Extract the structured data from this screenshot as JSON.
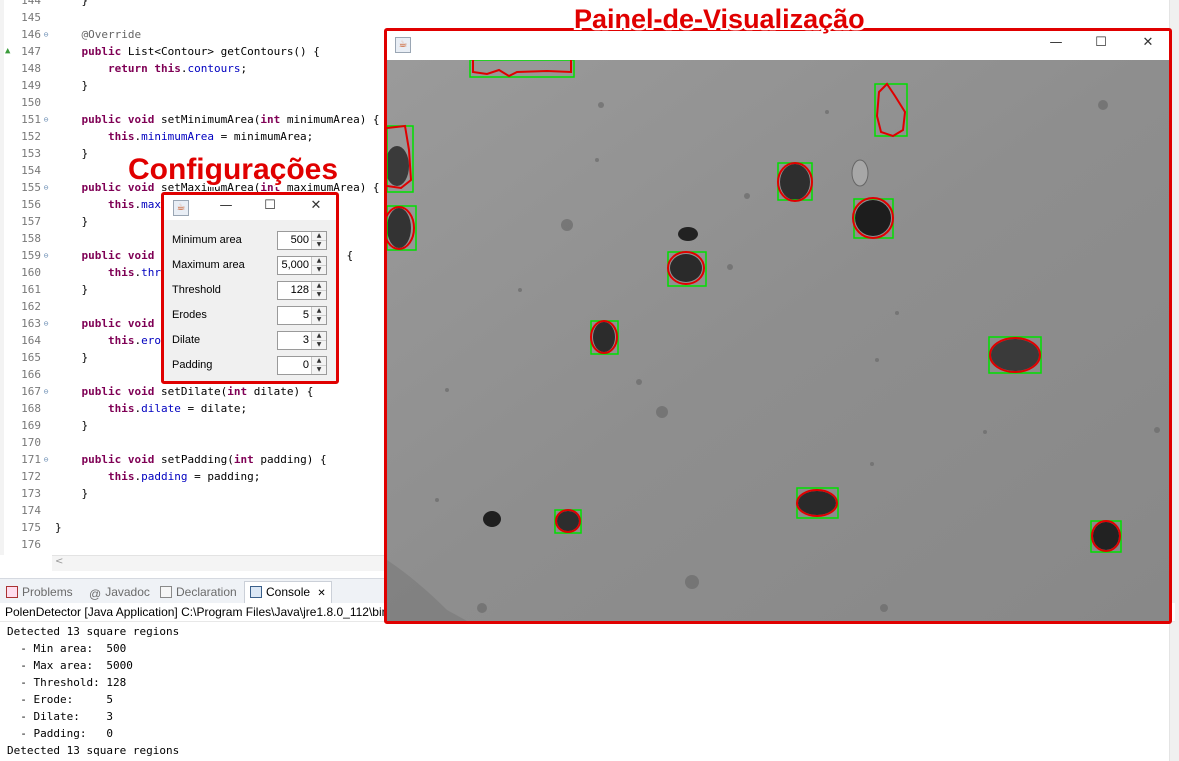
{
  "editor": {
    "lines": [
      {
        "num": "144",
        "code": "    }",
        "arrow": "",
        "fold": ""
      },
      {
        "num": "145",
        "code": "",
        "arrow": "",
        "fold": ""
      },
      {
        "num": "146",
        "code": "    @Override",
        "arrow": "",
        "fold": "⊖"
      },
      {
        "num": "147",
        "code": "    public List<Contour> getContours() {",
        "arrow": "▲",
        "fold": ""
      },
      {
        "num": "148",
        "code": "        return this.contours;",
        "arrow": "",
        "fold": ""
      },
      {
        "num": "149",
        "code": "    }",
        "arrow": "",
        "fold": ""
      },
      {
        "num": "150",
        "code": "",
        "arrow": "",
        "fold": ""
      },
      {
        "num": "151",
        "code": "    public void setMinimumArea(int minimumArea) {",
        "arrow": "",
        "fold": "⊖"
      },
      {
        "num": "152",
        "code": "        this.minimumArea = minimumArea;",
        "arrow": "",
        "fold": ""
      },
      {
        "num": "153",
        "code": "    }",
        "arrow": "",
        "fold": ""
      },
      {
        "num": "154",
        "code": "",
        "arrow": "",
        "fold": ""
      },
      {
        "num": "155",
        "code": "    public void setMaximumArea(int maximumArea) {",
        "arrow": "",
        "fold": "⊖"
      },
      {
        "num": "156",
        "code": "        this.maximumArea = maximumArea;",
        "arrow": "",
        "fold": ""
      },
      {
        "num": "157",
        "code": "    }",
        "arrow": "",
        "fold": ""
      },
      {
        "num": "158",
        "code": "",
        "arrow": "",
        "fold": ""
      },
      {
        "num": "159",
        "code": "    public void setThreshold(int threshold) {",
        "arrow": "",
        "fold": "⊖"
      },
      {
        "num": "160",
        "code": "        this.threshold = threshold;",
        "arrow": "",
        "fold": ""
      },
      {
        "num": "161",
        "code": "    }",
        "arrow": "",
        "fold": ""
      },
      {
        "num": "162",
        "code": "",
        "arrow": "",
        "fold": ""
      },
      {
        "num": "163",
        "code": "    public void setErodes(int erodes) {",
        "arrow": "",
        "fold": "⊖"
      },
      {
        "num": "164",
        "code": "        this.erodes = erodes;",
        "arrow": "",
        "fold": ""
      },
      {
        "num": "165",
        "code": "    }",
        "arrow": "",
        "fold": ""
      },
      {
        "num": "166",
        "code": "",
        "arrow": "",
        "fold": ""
      },
      {
        "num": "167",
        "code": "    public void setDilate(int dilate) {",
        "arrow": "",
        "fold": "⊖"
      },
      {
        "num": "168",
        "code": "        this.dilate = dilate;",
        "arrow": "",
        "fold": ""
      },
      {
        "num": "169",
        "code": "    }",
        "arrow": "",
        "fold": ""
      },
      {
        "num": "170",
        "code": "",
        "arrow": "",
        "fold": ""
      },
      {
        "num": "171",
        "code": "    public void setPadding(int padding) {",
        "arrow": "",
        "fold": "⊖"
      },
      {
        "num": "172",
        "code": "        this.padding = padding;",
        "arrow": "",
        "fold": ""
      },
      {
        "num": "173",
        "code": "    }",
        "arrow": "",
        "fold": ""
      },
      {
        "num": "174",
        "code": "",
        "arrow": "",
        "fold": ""
      },
      {
        "num": "175",
        "code": "}",
        "arrow": "",
        "fold": ""
      },
      {
        "num": "176",
        "code": "",
        "arrow": "",
        "fold": ""
      }
    ],
    "keywords": [
      "public",
      "void",
      "int",
      "return",
      "this"
    ]
  },
  "tabs": [
    {
      "label": "Problems",
      "icon": "problems-icon",
      "active": false
    },
    {
      "label": "Javadoc",
      "icon": "javadoc-icon",
      "active": false
    },
    {
      "label": "Declaration",
      "icon": "declaration-icon",
      "active": false
    },
    {
      "label": "Console",
      "icon": "console-icon",
      "active": true
    }
  ],
  "console": {
    "launch": "PolenDetector [Java Application] C:\\Program Files\\Java\\jre1.8.0_112\\bin",
    "lines": [
      "Detected 13 square regions",
      "  - Min area:  500",
      "  - Max area:  5000",
      "  - Threshold: 128",
      "  - Erode:     5",
      "  - Dilate:    3",
      "  - Padding:   0",
      "Detected 13 square regions"
    ]
  },
  "viewer": {
    "annotation": "Painel-de-Visualização",
    "controls": {
      "minimize": "—",
      "maximize": "☐",
      "close": "✕"
    },
    "background_color": "#8f8f8f",
    "box_color": "#00e000",
    "contour_color": "#e00000"
  },
  "settings": {
    "annotation": "Configurações",
    "controls": {
      "minimize": "—",
      "maximize": "☐",
      "close": "✕"
    },
    "fields": [
      {
        "label": "Minimum area",
        "value": "500"
      },
      {
        "label": "Maximum area",
        "value": "5,000"
      },
      {
        "label": "Threshold",
        "value": "128"
      },
      {
        "label": "Erodes",
        "value": "5"
      },
      {
        "label": "Dilate",
        "value": "3"
      },
      {
        "label": "Padding",
        "value": "0"
      }
    ]
  },
  "highlight_color": "#e00000",
  "java_icon_glyph": "☕",
  "scroll_left_glyph": "<"
}
